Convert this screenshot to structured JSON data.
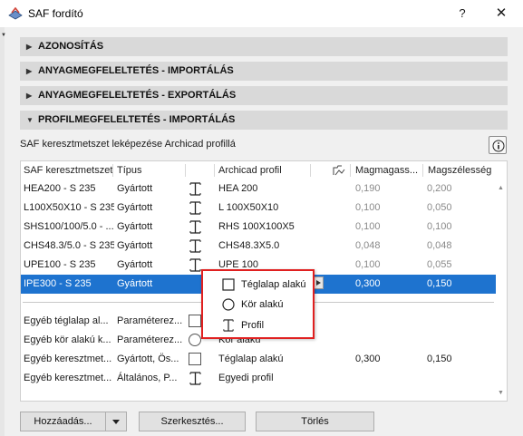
{
  "window": {
    "title": "SAF fordító",
    "help_label": "?",
    "close_label": "✕"
  },
  "sections": [
    {
      "label": "AZONOSÍTÁS",
      "expanded": false
    },
    {
      "label": "ANYAGMEGFELELTETÉS - IMPORTÁLÁS",
      "expanded": false
    },
    {
      "label": "ANYAGMEGFELELTETÉS - EXPORTÁLÁS",
      "expanded": false
    },
    {
      "label": "PROFILMEGFELELTETÉS - IMPORTÁLÁS",
      "expanded": true
    }
  ],
  "profile_section": {
    "subtitle": "SAF keresztmetszet leképezése Archicad profillá",
    "info_icon": "info-icon",
    "columns": [
      "SAF keresztmetszet",
      "Típus",
      "",
      "Archicad profil",
      "",
      "Magmagass...",
      "Magszélesség"
    ],
    "rows": [
      {
        "saf": "HEA200 - S 235",
        "type": "Gyártott",
        "icon": "i-beam-icon",
        "archicad": "HEA 200",
        "height": "0,190",
        "width": "0,200",
        "selected": false
      },
      {
        "saf": "L100X50X10 - S 235",
        "type": "Gyártott",
        "icon": "i-beam-icon",
        "archicad": "L 100X50X10",
        "height": "0,100",
        "width": "0,050",
        "selected": false
      },
      {
        "saf": "SHS100/100/5.0 - ...",
        "type": "Gyártott",
        "icon": "i-beam-icon",
        "archicad": "RHS 100X100X5",
        "height": "0,100",
        "width": "0,100",
        "selected": false
      },
      {
        "saf": "CHS48.3/5.0 - S 235",
        "type": "Gyártott",
        "icon": "i-beam-icon",
        "archicad": "CHS48.3X5.0",
        "height": "0,048",
        "width": "0,048",
        "selected": false
      },
      {
        "saf": "UPE100 - S 235",
        "type": "Gyártott",
        "icon": "i-beam-icon",
        "archicad": "UPE 100",
        "height": "0,100",
        "width": "0,055",
        "selected": false
      },
      {
        "saf": "IPE300 - S 235",
        "type": "Gyártott",
        "icon": "i-beam-icon",
        "archicad": "",
        "height": "0,300",
        "width": "0,150",
        "selected": true
      }
    ],
    "other_rows": [
      {
        "saf": "Egyéb téglalap al...",
        "type": "Paraméterez...",
        "icon": "checkbox-icon",
        "archicad": "",
        "height": "",
        "width": ""
      },
      {
        "saf": "Egyéb kör alakú k...",
        "type": "Paraméterez...",
        "icon": "radio-icon",
        "archicad": "Kör alakú",
        "height": "",
        "width": ""
      },
      {
        "saf": "Egyéb keresztmet...",
        "type": "Gyártott, Ös...",
        "icon": "checkbox-icon",
        "archicad": "Téglalap alakú",
        "height": "0,300",
        "width": "0,150"
      },
      {
        "saf": "Egyéb keresztmet...",
        "type": "Általános, P...",
        "icon": "i-beam-icon",
        "archicad": "Egyedi profil",
        "height": "",
        "width": ""
      }
    ]
  },
  "profile_popup": {
    "items": [
      {
        "label": "Téglalap alakú",
        "icon": "rectangle-shape-icon"
      },
      {
        "label": "Kör alakú",
        "icon": "circle-shape-icon"
      },
      {
        "label": "Profil",
        "icon": "i-beam-icon"
      }
    ],
    "highlight_color": "#e02020"
  },
  "buttons": {
    "add": "Hozzáadás...",
    "edit": "Szerkesztés...",
    "delete": "Törlés"
  },
  "colors": {
    "selection": "#1e73cf",
    "section_bg": "#d9d9d9"
  }
}
